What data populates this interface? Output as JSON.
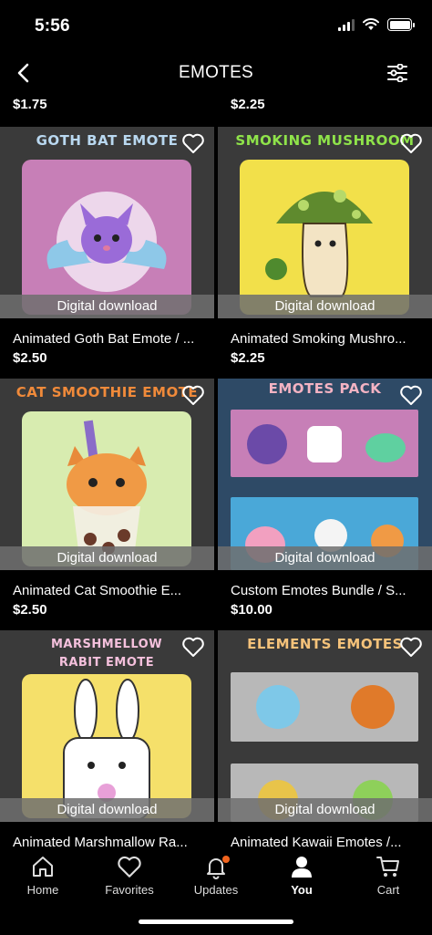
{
  "status": {
    "time": "5:56"
  },
  "header": {
    "title": "EMOTES",
    "back_icon": "chevron-left-icon",
    "filter_icon": "sliders-icon"
  },
  "top_prices": [
    "$1.75",
    "$2.25"
  ],
  "listings": [
    {
      "thumb_title": "GOTH BAT EMOTE",
      "thumb_title_color": "#b9d8f0",
      "panel_color": "#c77fb7",
      "download_label": "Digital download",
      "title": "Animated Goth Bat Emote / ...",
      "price": "$2.50"
    },
    {
      "thumb_title": "SMOKING MUSHROOM",
      "thumb_title_color": "#8fe34a",
      "panel_color": "#f2e04a",
      "download_label": "Digital download",
      "title": "Animated Smoking Mushro...",
      "price": "$2.25"
    },
    {
      "thumb_title": "CAT SMOOTHIE EMOTE",
      "thumb_title_color": "#f08a3a",
      "panel_color": "#d8ecb0",
      "download_label": "Digital download",
      "title": "Animated Cat Smoothie E...",
      "price": "$2.50"
    },
    {
      "thumb_title": "EMOTES PACK",
      "thumb_title_color": "#f3b3c3",
      "panel_color": "#c77fb7",
      "download_label": "Digital download",
      "title": "Custom Emotes Bundle / S...",
      "price": "$10.00"
    },
    {
      "thumb_title": "MARSHMELLOW RABIT EMOTE",
      "thumb_title_color": "#f4c0dc",
      "panel_color": "#f5e06a",
      "download_label": "Digital download",
      "title": "Animated Marshmallow Ra...",
      "price": ""
    },
    {
      "thumb_title": "ELEMENTS EMOTES",
      "thumb_title_color": "#f5c27a",
      "panel_color": "#b8b8b8",
      "download_label": "Digital download",
      "title": "Animated Kawaii Emotes /...",
      "price": ""
    }
  ],
  "tabbar": {
    "items": [
      {
        "label": "Home",
        "icon": "home-icon"
      },
      {
        "label": "Favorites",
        "icon": "heart-icon"
      },
      {
        "label": "Updates",
        "icon": "bell-icon"
      },
      {
        "label": "You",
        "icon": "user-icon"
      },
      {
        "label": "Cart",
        "icon": "cart-icon"
      }
    ],
    "active": "You"
  },
  "colors": {
    "background": "#000000",
    "badge": "#f1641e",
    "download_bar": "#6e6e6e"
  }
}
